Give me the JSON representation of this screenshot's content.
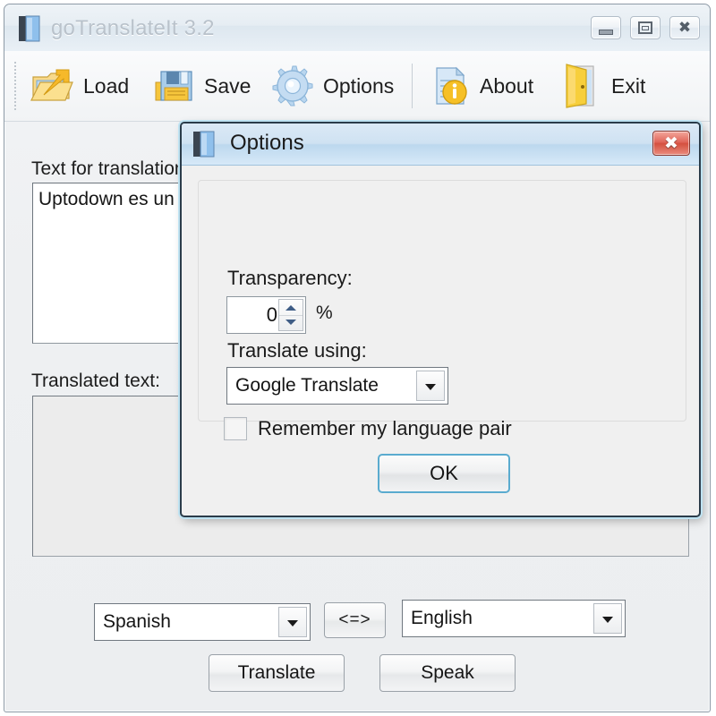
{
  "main_window": {
    "title": "goTranslateIt 3.2",
    "title_icon": "book-icon",
    "controls": {
      "minimize": "minimize-icon",
      "maximize": "maximize-icon",
      "close": "close-icon"
    },
    "toolbar": [
      {
        "label": "Load",
        "icon": "open-folder-arrow-icon"
      },
      {
        "label": "Save",
        "icon": "floppy-disk-icon"
      },
      {
        "label": "Options",
        "icon": "gear-icon"
      },
      {
        "label": "About",
        "icon": "document-info-icon"
      },
      {
        "label": "Exit",
        "icon": "open-door-icon"
      }
    ],
    "source": {
      "label": "Text for translation:",
      "value": "Uptodown es un"
    },
    "target": {
      "label": "Translated text:",
      "value": ""
    },
    "languages": {
      "source_lang": "Spanish",
      "target_lang": "English",
      "swap_label": "<=>"
    },
    "actions": {
      "translate": "Translate",
      "speak": "Speak"
    }
  },
  "options_dialog": {
    "title": "Options",
    "title_icon": "book-icon",
    "close_label": "X",
    "transparency": {
      "label": "Transparency:",
      "value": "0",
      "unit": "%"
    },
    "engine": {
      "label": "Translate using:",
      "value": "Google Translate"
    },
    "remember": {
      "label": "Remember my language pair",
      "checked": false
    },
    "ok_label": "OK"
  },
  "colors": {
    "accent_blue": "#5aabcf",
    "close_red": "#d4503f",
    "title_inactive": "#b9c2cb",
    "window_bg": "#f0f0f0"
  }
}
